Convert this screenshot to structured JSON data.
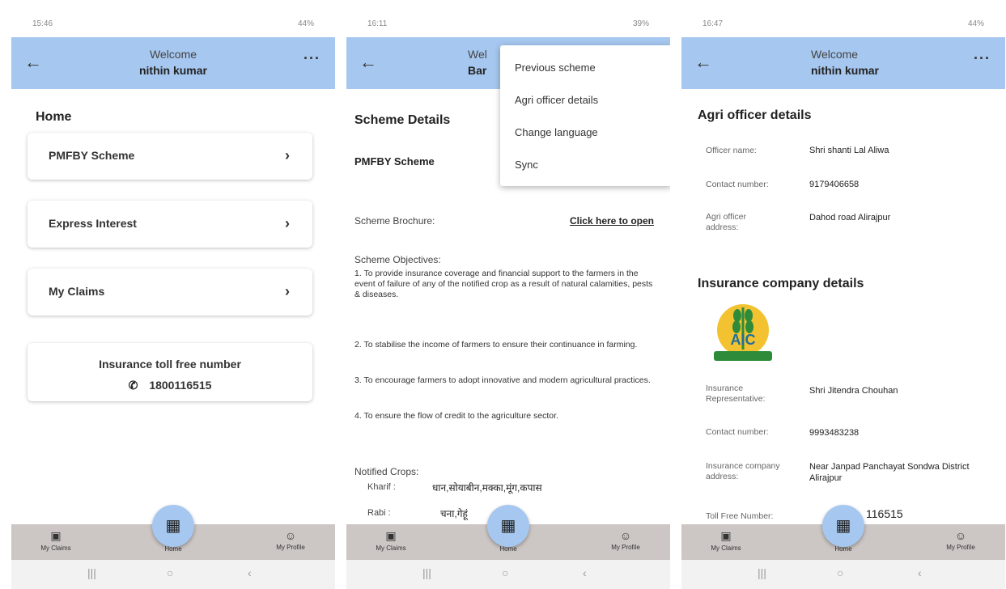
{
  "screens": [
    {
      "status_time": "15:46",
      "status_right": "44%",
      "header": {
        "welcome": "Welcome",
        "name": "nithin kumar"
      },
      "title": "Home",
      "menu_cards": [
        {
          "label": "PMFBY Scheme"
        },
        {
          "label": "Express Interest"
        },
        {
          "label": "My Claims"
        }
      ],
      "toll": {
        "title": "Insurance toll free number",
        "number": "1800116515"
      }
    },
    {
      "status_time": "16:11",
      "status_right": "39%",
      "header": {
        "welcome": "Wel",
        "name": "Bar"
      },
      "overflow_menu": [
        "Previous scheme",
        "Agri officer details",
        "Change language",
        "Sync"
      ],
      "section_title": "Scheme Details",
      "scheme_name": "PMFBY Scheme",
      "brochure_label": "Scheme Brochure:",
      "brochure_link": "Click here to open",
      "objectives_label": "Scheme Objectives:",
      "objectives": [
        "1. To provide insurance coverage and financial support to the farmers in the event of failure of any of the notified crop as a result of natural calamities, pests & diseases.",
        "2. To stabilise the income of farmers to ensure their continuance in farming.",
        "3. To encourage farmers to adopt innovative and modern agricultural practices.",
        "4. To ensure the flow of credit to the agriculture sector."
      ],
      "notified_label": "Notified Crops:",
      "kharif_label": "Kharif :",
      "kharif_value": "धान,सोयाबीन,मक्का,मूंग,कपास",
      "rabi_label": "Rabi :",
      "rabi_value": "चना,गेहूं"
    },
    {
      "status_time": "16:47",
      "status_right": "44%",
      "header": {
        "welcome": "Welcome",
        "name": "nithin kumar"
      },
      "agri_title": "Agri officer details",
      "agri_rows": [
        {
          "k": "Officer name:",
          "v": "Shri shanti Lal Aliwa"
        },
        {
          "k": "Contact number:",
          "v": "9179406658"
        },
        {
          "k": "Agri officer address:",
          "v": "Dahod road Alirajpur"
        }
      ],
      "ins_title": "Insurance company details",
      "logo_text": "AIC",
      "ins_rows": [
        {
          "k": "Insurance Representative:",
          "v": "Shri Jitendra Chouhan"
        },
        {
          "k": "Contact number:",
          "v": "9993483238"
        },
        {
          "k": "Insurance company address:",
          "v": "Near Janpad Panchayat Sondwa District Alirajpur"
        },
        {
          "k": "Toll Free Number:",
          "v": "116515"
        }
      ]
    }
  ],
  "bottom_nav": {
    "left": "My Claims",
    "center": "Home",
    "right": "My Profile"
  },
  "colors": {
    "appbar": "#a6c7ef",
    "navbar": "#ccc6c4"
  }
}
